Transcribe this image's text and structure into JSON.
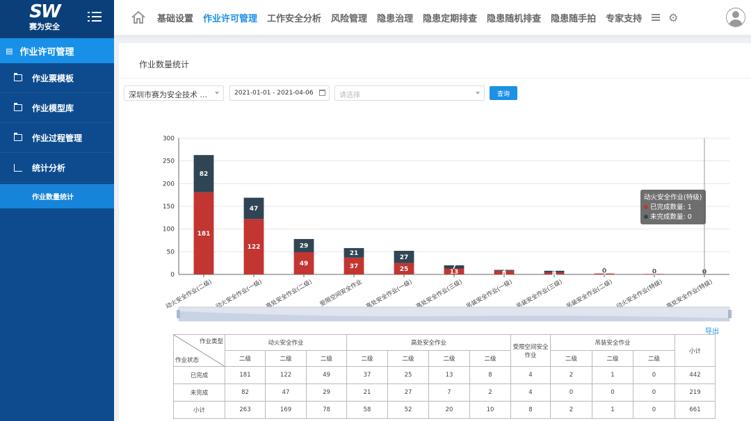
{
  "brand": {
    "mark": "SW",
    "name": "赛为安全"
  },
  "topnav": [
    "基础设置",
    "作业许可管理",
    "工作安全分析",
    "风险管理",
    "隐患治理",
    "隐患定期排查",
    "隐患随机排查",
    "隐患随手拍",
    "专家支持"
  ],
  "topnav_active_index": 1,
  "sidebar": {
    "section": "作业许可管理",
    "items": [
      "作业票模板",
      "作业模型库",
      "作业过程管理",
      "统计分析"
    ],
    "sub_item": "作业数量统计"
  },
  "page_title": "作业数量统计",
  "filters": {
    "company": "深圳市赛为安全技术 ...",
    "date_range": "2021-01-01 - 2021-04-06",
    "type_placeholder": "请选择",
    "query_label": "查询"
  },
  "chart_data": {
    "type": "bar",
    "stacked": true,
    "categories": [
      "动火安全作业(二级)",
      "动火安全作业(一级)",
      "高处安全作业(二级)",
      "受限空间安全作业",
      "高处安全作业(一级)",
      "高处安全作业(三级)",
      "吊装安全作业(一级)",
      "吊装安全作业(三级)",
      "吊装安全作业(二级)",
      "动火安全作业(特级)",
      "高处安全作业(特级)"
    ],
    "series": [
      {
        "name": "已完成数量",
        "color": "#c23531",
        "values": [
          181,
          122,
          49,
          37,
          25,
          13,
          8,
          4,
          2,
          1,
          0
        ]
      },
      {
        "name": "未完成数量",
        "color": "#2f4554",
        "values": [
          82,
          47,
          29,
          21,
          27,
          7,
          2,
          4,
          0,
          0,
          0
        ]
      }
    ],
    "ylim": [
      0,
      300
    ],
    "yticks": [
      0,
      50,
      100,
      150,
      200,
      250,
      300
    ],
    "tooltip": {
      "title": "动火安全作业(特级)",
      "lines": [
        "已完成数量: 1",
        "未完成数量: 0"
      ]
    },
    "grid": true
  },
  "export_label": "导出",
  "table": {
    "corner_top": "作业类型",
    "corner_bottom": "作业状态",
    "groups": [
      {
        "name": "动火安全作业",
        "levels": [
          "二级",
          "二级",
          "二级"
        ]
      },
      {
        "name": "高处安全作业",
        "levels": [
          "二级",
          "二级",
          "二级",
          "二级"
        ]
      },
      {
        "name": "受限空间安全作业",
        "levels": []
      },
      {
        "name": "吊装安全作业",
        "levels": [
          "二级",
          "二级",
          "二级"
        ]
      }
    ],
    "total_label": "小计",
    "rows": [
      {
        "label": "已完成",
        "values": [
          "181",
          "122",
          "49",
          "37",
          "25",
          "13",
          "8",
          "4",
          "2",
          "1",
          "0",
          "442"
        ]
      },
      {
        "label": "未完成",
        "values": [
          "82",
          "47",
          "29",
          "21",
          "27",
          "7",
          "2",
          "4",
          "0",
          "0",
          "0",
          "219"
        ]
      },
      {
        "label": "小计",
        "values": [
          "263",
          "169",
          "78",
          "58",
          "52",
          "20",
          "10",
          "8",
          "2",
          "1",
          "0",
          "661"
        ]
      }
    ]
  }
}
